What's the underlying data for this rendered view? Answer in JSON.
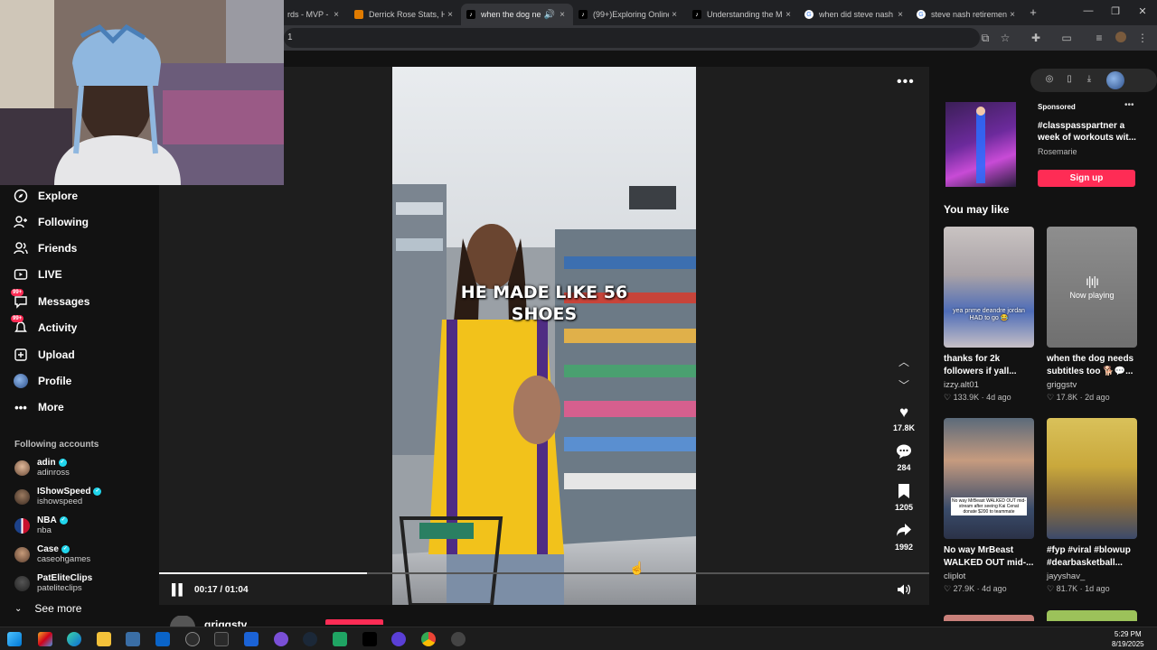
{
  "browser": {
    "tabs": [
      {
        "title": "rds - MVP -",
        "active": false
      },
      {
        "title": "Derrick Rose Stats, He",
        "active": false
      },
      {
        "title": "when the dog ne",
        "active": true
      },
      {
        "title": "(99+)Exploring Online",
        "active": false
      },
      {
        "title": "Understanding the M",
        "active": false
      },
      {
        "title": "when did steve nash l",
        "active": false
      },
      {
        "title": "steve nash retiremen",
        "active": false
      }
    ],
    "address_fragment": "1",
    "new_tab": "+",
    "close_glyph": "×"
  },
  "sidebar": {
    "items": [
      {
        "label": "Explore",
        "icon": "compass-icon"
      },
      {
        "label": "Following",
        "icon": "following-icon"
      },
      {
        "label": "Friends",
        "icon": "friends-icon"
      },
      {
        "label": "LIVE",
        "icon": "live-icon"
      },
      {
        "label": "Messages",
        "icon": "messages-icon",
        "badge": "99+"
      },
      {
        "label": "Activity",
        "icon": "activity-icon",
        "badge": "99+"
      },
      {
        "label": "Upload",
        "icon": "upload-icon"
      },
      {
        "label": "Profile",
        "icon": "profile-icon"
      },
      {
        "label": "More",
        "icon": "more-icon"
      }
    ],
    "following_title": "Following accounts",
    "accounts": [
      {
        "name": "adin",
        "handle": "adinross",
        "verified": true
      },
      {
        "name": "IShowSpeed",
        "handle": "ishowspeed",
        "verified": true
      },
      {
        "name": "NBA",
        "handle": "nba",
        "verified": true
      },
      {
        "name": "Case",
        "handle": "caseohgames",
        "verified": true
      },
      {
        "name": "PatEliteClips",
        "handle": "pateliteclips",
        "verified": false
      }
    ],
    "see_more": "See more"
  },
  "player": {
    "overlay_line1": "HE MADE LIKE 56",
    "overlay_line2": "SHOES",
    "time": "00:17 / 01:04",
    "progress": 0.27,
    "likes": "17.8K",
    "comments": "284",
    "saves": "1205",
    "shares": "1992",
    "author_partial": "griggstv"
  },
  "right": {
    "sponsored_label": "Sponsored",
    "sponsored_title": "#classpasspartner a week of workouts wit...",
    "sponsored_author": "Rosemarie",
    "signup": "Sign up",
    "you_may_like": "You may like",
    "now_playing": "Now playing",
    "cards": [
      {
        "title": "thanks for 2k followers if yall...",
        "author": "izzy.alt01",
        "likes": "133.9K",
        "age": "4d ago",
        "overlay": "yea pnme deandre jordan HAD to go 😂"
      },
      {
        "title": "when the dog needs subtitles too 🐕💬...",
        "author": "griggstv",
        "likes": "17.8K",
        "age": "2d ago",
        "overlay": ""
      },
      {
        "title": "No way MrBeast WALKED OUT mid-...",
        "author": "cliplot",
        "likes": "27.9K",
        "age": "4d ago",
        "overlay": "No way MrBeast WALKED OUT mid-stream after seeing Kai Cenat donate $200 to teammate"
      },
      {
        "title": "#fyp #viral #blowup #dearbasketball...",
        "author": "jayyshav_",
        "likes": "81.7K",
        "age": "1d ago",
        "overlay": ""
      }
    ]
  },
  "taskbar": {
    "time": "5:29 PM",
    "date": "8/19/2025"
  },
  "colors": {
    "accent": "#fe2c55",
    "verified": "#20d5ec"
  }
}
